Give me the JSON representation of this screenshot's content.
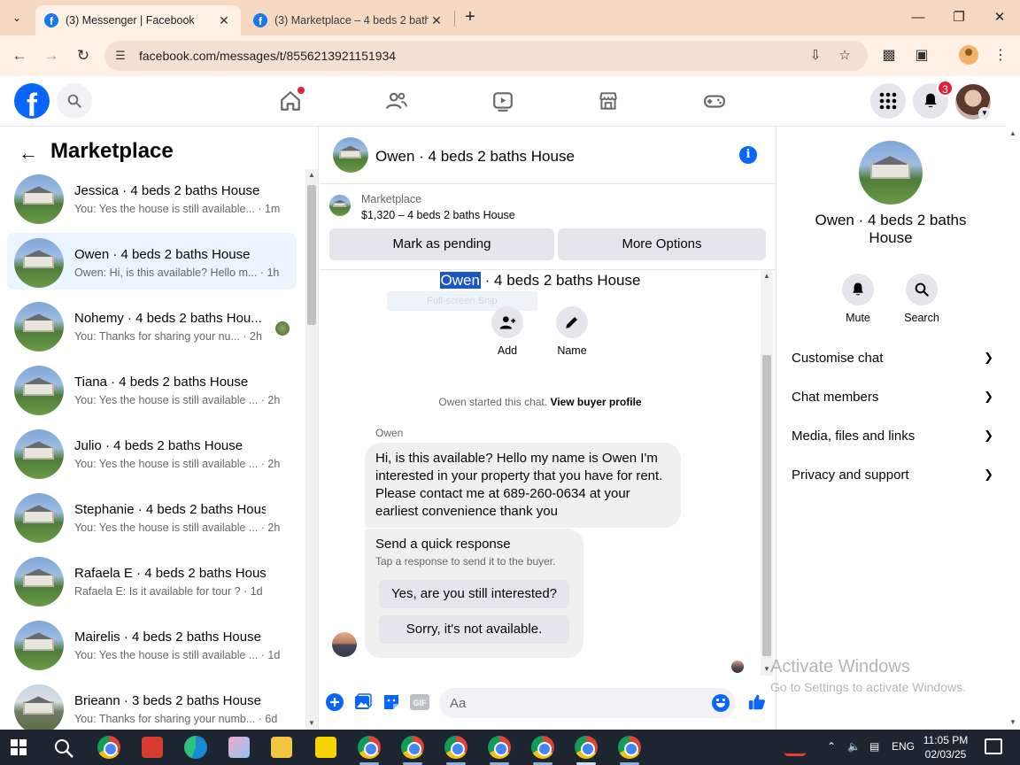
{
  "browser": {
    "tabs": [
      {
        "title": "(3) Messenger | Facebook",
        "active": true
      },
      {
        "title": "(3) Marketplace – 4 beds 2 bath",
        "active": false
      }
    ],
    "url": "facebook.com/messages/t/8556213921151934"
  },
  "facebook": {
    "logo": "f",
    "notification_count": "3"
  },
  "left": {
    "title": "Marketplace",
    "conversations": [
      {
        "name": "Jessica · 4 beds 2 baths House",
        "snippet": "You: Yes the house is still available... · 1m",
        "avatar": "house"
      },
      {
        "name": "Owen · 4 beds 2 baths House",
        "snippet": "Owen: Hi, is this available? Hello m... · 1h",
        "avatar": "house",
        "selected": true
      },
      {
        "name": "Nohemy · 4 beds 2 baths Hou...",
        "snippet": "You: Thanks for sharing your nu... · 2h",
        "avatar": "house"
      },
      {
        "name": "Tiana · 4 beds 2 baths House",
        "snippet": "You: Yes the house is still available ... · 2h",
        "avatar": "house"
      },
      {
        "name": "Julio · 4 beds 2 baths House",
        "snippet": "You: Yes the house is still available ... · 2h",
        "avatar": "house"
      },
      {
        "name": "Stephanie · 4 beds 2 baths House",
        "snippet": "You: Yes the house is still available ... · 2h",
        "avatar": "house"
      },
      {
        "name": "Rafaela E · 4 beds 2 baths House",
        "snippet": "Rafaela E: Is it available for tour ? · 1d",
        "avatar": "house"
      },
      {
        "name": "Mairelis · 4 beds 2 baths House",
        "snippet": "You: Yes the house is still available ... · 1d",
        "avatar": "house"
      },
      {
        "name": "Brieann · 3 beds 2 baths House",
        "snippet": "You: Thanks for sharing your numb... · 6d",
        "avatar": "house-alt"
      }
    ]
  },
  "chat": {
    "title": "Owen · 4 beds 2 baths House",
    "listing_category": "Marketplace",
    "listing_price": "$1,320 – 4 beds 2 baths House",
    "mark_pending": "Mark as pending",
    "more_options": "More Options",
    "thread_name_highlight": "Owen",
    "thread_name_rest": " · 4 beds 2 baths House",
    "ghost_pill": "Full-screen Snip",
    "actions": {
      "add": "Add",
      "name": "Name"
    },
    "started_prefix": "Owen started this chat.",
    "started_link": "View buyer profile",
    "sender": "Owen",
    "message": "Hi, is this available? Hello my name is Owen I'm interested in your property that you have for rent. Please contact me at 689-260-0634 at your earliest convenience thank you",
    "quick_title": "Send a quick response",
    "quick_subtitle": "Tap a response to send it to the buyer.",
    "quick_reply_1": "Yes, are you still interested?",
    "quick_reply_2": "Sorry, it's not available.",
    "composer_placeholder": "Aa"
  },
  "right": {
    "name": "Owen · 4 beds 2 baths House",
    "mute": "Mute",
    "search": "Search",
    "sections": [
      "Customise chat",
      "Chat members",
      "Media, files and links",
      "Privacy and support"
    ]
  },
  "watermark": {
    "line1": "Activate Windows",
    "line2": "Go to Settings to activate Windows."
  },
  "taskbar": {
    "lang": "ENG",
    "time": "11:05 PM",
    "date": "02/03/25"
  }
}
